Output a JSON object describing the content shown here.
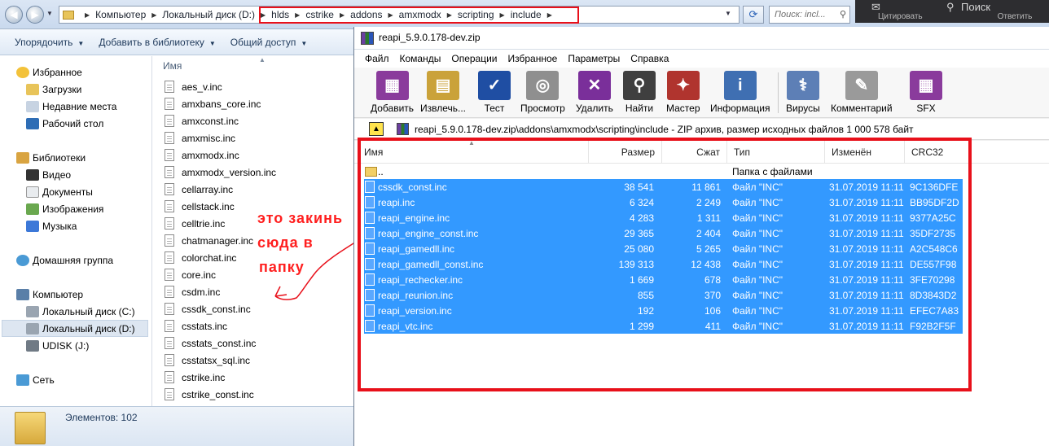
{
  "explorer": {
    "breadcrumbs": [
      "Компьютер",
      "Локальный диск (D:)",
      "hlds",
      "cstrike",
      "addons",
      "amxmodx",
      "scripting",
      "include"
    ],
    "search_placeholder": "Поиск: incl...",
    "toolbar": [
      "Упорядочить",
      "Добавить в библиотеку",
      "Общий доступ"
    ],
    "nav": {
      "favorites": "Избранное",
      "downloads": "Загрузки",
      "recent": "Недавние места",
      "desktop": "Рабочий стол",
      "libraries": "Библиотеки",
      "video": "Видео",
      "documents": "Документы",
      "pictures": "Изображения",
      "music": "Музыка",
      "homegroup": "Домашняя группа",
      "computer": "Компьютер",
      "drive_c": "Локальный диск (C:)",
      "drive_d": "Локальный диск (D:)",
      "udisk": "UDISK (J:)",
      "network": "Сеть"
    },
    "column_name": "Имя",
    "files": [
      "aes_v.inc",
      "amxbans_core.inc",
      "amxconst.inc",
      "amxmisc.inc",
      "amxmodx.inc",
      "amxmodx_version.inc",
      "cellarray.inc",
      "cellstack.inc",
      "celltrie.inc",
      "chatmanager.inc",
      "colorchat.inc",
      "core.inc",
      "csdm.inc",
      "cssdk_const.inc",
      "csstats.inc",
      "csstats_const.inc",
      "csstatsx_sql.inc",
      "cstrike.inc",
      "cstrike_const.inc"
    ],
    "status": "Элементов: 102"
  },
  "dark_strip": {
    "left_text": "Цитировать",
    "right_text": "Поиск",
    "sub_text": "Цитировать",
    "sub_text2": "Ответить"
  },
  "annotation": {
    "line1": "это закинь",
    "line2": "сюда  в",
    "line3": "папку",
    "color": "#ff1f1f"
  },
  "winrar": {
    "title": "reapi_5.9.0.178-dev.zip",
    "menu": [
      "Файл",
      "Команды",
      "Операции",
      "Избранное",
      "Параметры",
      "Справка"
    ],
    "tools": [
      {
        "label": "Добавить",
        "icon": "add-archive-icon",
        "color": "#8a3b9c"
      },
      {
        "label": "Извлечь...",
        "icon": "extract-icon",
        "color": "#caa23a"
      },
      {
        "label": "Тест",
        "icon": "test-icon",
        "color": "#1f4ea3"
      },
      {
        "label": "Просмотр",
        "icon": "view-icon",
        "color": "#8f8f8f"
      },
      {
        "label": "Удалить",
        "icon": "delete-icon",
        "color": "#7a2f9a"
      },
      {
        "label": "Найти",
        "icon": "find-icon",
        "color": "#3f3f3f"
      },
      {
        "label": "Мастер",
        "icon": "wizard-icon",
        "color": "#b0342e"
      },
      {
        "label": "Информация",
        "icon": "info-icon",
        "color": "#3f6fb2"
      },
      {
        "label": "Вирусы",
        "icon": "virus-scan-icon",
        "color": "#5d7fb6"
      },
      {
        "label": "Комментарий",
        "icon": "comment-icon",
        "color": "#9a9a9a"
      },
      {
        "label": "SFX",
        "icon": "sfx-icon",
        "color": "#8a3b9c"
      }
    ],
    "path": "reapi_5.9.0.178-dev.zip\\addons\\amxmodx\\scripting\\include - ZIP архив, размер исходных файлов 1 000 578 байт",
    "columns": {
      "name": "Имя",
      "size": "Размер",
      "packed": "Сжат",
      "type": "Тип",
      "modified": "Изменён",
      "crc": "CRC32"
    },
    "parent": {
      "name": "..",
      "type": "Папка с файлами"
    },
    "rows": [
      {
        "name": "cssdk_const.inc",
        "size": "38 541",
        "packed": "11 861",
        "type": "Файл \"INC\"",
        "modified": "31.07.2019 11:11",
        "crc": "9C136DFE"
      },
      {
        "name": "reapi.inc",
        "size": "6 324",
        "packed": "2 249",
        "type": "Файл \"INC\"",
        "modified": "31.07.2019 11:11",
        "crc": "BB95DF2D"
      },
      {
        "name": "reapi_engine.inc",
        "size": "4 283",
        "packed": "1 311",
        "type": "Файл \"INC\"",
        "modified": "31.07.2019 11:11",
        "crc": "9377A25C"
      },
      {
        "name": "reapi_engine_const.inc",
        "size": "29 365",
        "packed": "2 404",
        "type": "Файл \"INC\"",
        "modified": "31.07.2019 11:11",
        "crc": "35DF2735"
      },
      {
        "name": "reapi_gamedll.inc",
        "size": "25 080",
        "packed": "5 265",
        "type": "Файл \"INC\"",
        "modified": "31.07.2019 11:11",
        "crc": "A2C548C6"
      },
      {
        "name": "reapi_gamedll_const.inc",
        "size": "139 313",
        "packed": "12 438",
        "type": "Файл \"INC\"",
        "modified": "31.07.2019 11:11",
        "crc": "DE557F98"
      },
      {
        "name": "reapi_rechecker.inc",
        "size": "1 669",
        "packed": "678",
        "type": "Файл \"INC\"",
        "modified": "31.07.2019 11:11",
        "crc": "3FE70298"
      },
      {
        "name": "reapi_reunion.inc",
        "size": "855",
        "packed": "370",
        "type": "Файл \"INC\"",
        "modified": "31.07.2019 11:11",
        "crc": "8D3843D2"
      },
      {
        "name": "reapi_version.inc",
        "size": "192",
        "packed": "106",
        "type": "Файл \"INC\"",
        "modified": "31.07.2019 11:11",
        "crc": "EFEC7A83"
      },
      {
        "name": "reapi_vtc.inc",
        "size": "1 299",
        "packed": "411",
        "type": "Файл \"INC\"",
        "modified": "31.07.2019 11:11",
        "crc": "F92B2F5F"
      }
    ]
  }
}
